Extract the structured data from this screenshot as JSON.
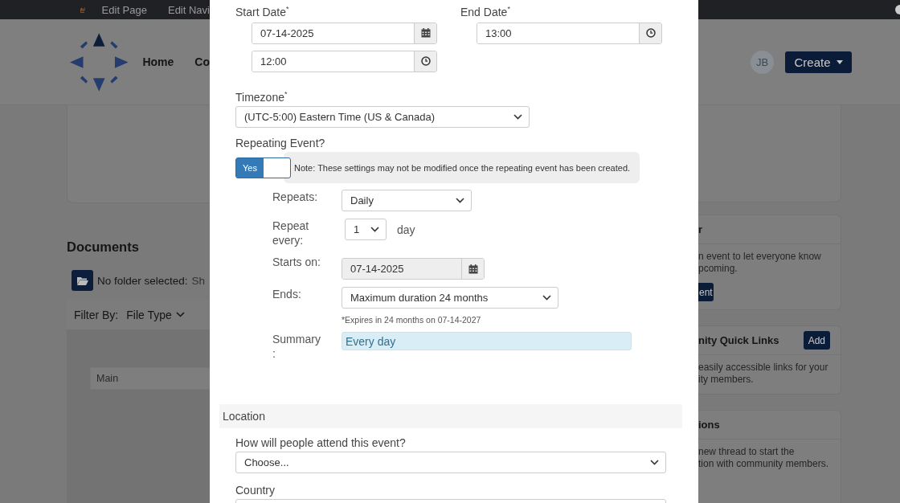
{
  "top_bar": {
    "links": [
      {
        "label": "Edit Page"
      },
      {
        "label": "Edit Navi"
      }
    ]
  },
  "header": {
    "nav": [
      {
        "label": "Home"
      },
      {
        "label": "Co"
      }
    ],
    "avatar": "JB",
    "create_button": "Create"
  },
  "documents": {
    "title": "Documents",
    "folder_label": "No folder selected:",
    "folder_value": "Sh",
    "filter_label": "Filter By:",
    "filter_value": "File Type",
    "rows": [
      "Main"
    ]
  },
  "side_cards": [
    {
      "title": "r",
      "lines": [
        "n event to let everyone know",
        "pcoming."
      ],
      "button": "ent"
    },
    {
      "title": "nity Quick Links",
      "header_button": "Add",
      "lines": [
        "easily accessible links for your",
        "ity members."
      ]
    },
    {
      "title": "ions",
      "lines": [
        "new thread to start the",
        "tion with community members."
      ]
    }
  ],
  "event_form": {
    "start_date": {
      "label": "Start Date$^{*}$",
      "date": "07-14-2025",
      "time": "12:00"
    },
    "end_date": {
      "label": "End Date$^{*}$",
      "time": "13:00"
    },
    "timezone": {
      "label": "Timezone$^{*}$",
      "value": "(UTC-5:00) Eastern Time (US & Canada)"
    },
    "repeating": {
      "label": "Repeating Event?",
      "on": true,
      "toggle_label": "Yes",
      "note": "Note: These settings may not be modified once the repeating event has been created."
    },
    "repeat_rows": [
      {
        "kind": "select",
        "label": "Repeats:",
        "value": "Daily"
      },
      {
        "kind": "select_unit",
        "label": "Repeat every:",
        "value": "1",
        "unit": "day"
      },
      {
        "kind": "date",
        "label": "Starts on:",
        "value": "07-14-2025",
        "disabled": true
      },
      {
        "kind": "select",
        "label": "Ends:",
        "value": "Maximum duration 24 months",
        "help": "*Expires in 24 months on 07-14-2027"
      },
      {
        "kind": "summary",
        "label": "Summary :",
        "value": "Every day"
      }
    ],
    "location": {
      "title": "Location",
      "fields": [
        {
          "label": "How will people attend this event?",
          "value": "Choose..."
        },
        {
          "label": "Country"
        }
      ]
    }
  }
}
